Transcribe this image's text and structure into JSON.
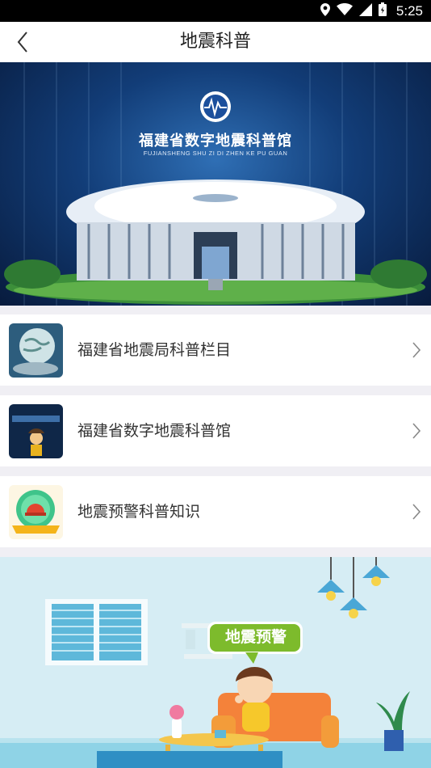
{
  "status_bar": {
    "time": "5:25"
  },
  "app_bar": {
    "title": "地震科普"
  },
  "banner": {
    "title": "福建省数字地震科普馆",
    "subtitle": "FUJIANSHENG SHU ZI DI ZHEN KE PU GUAN"
  },
  "list": {
    "items": [
      {
        "label": "福建省地震局科普栏目",
        "thumb": "globe-thumbnail"
      },
      {
        "label": "福建省数字地震科普馆",
        "thumb": "museum-thumbnail"
      },
      {
        "label": "地震预警科普知识",
        "thumb": "alarm-thumbnail"
      }
    ]
  },
  "illustration": {
    "bubble_text": "地震预警"
  },
  "colors": {
    "accent_green": "#7dbb2c",
    "sofa": "#f4823a",
    "sky": "#d6edf4"
  }
}
